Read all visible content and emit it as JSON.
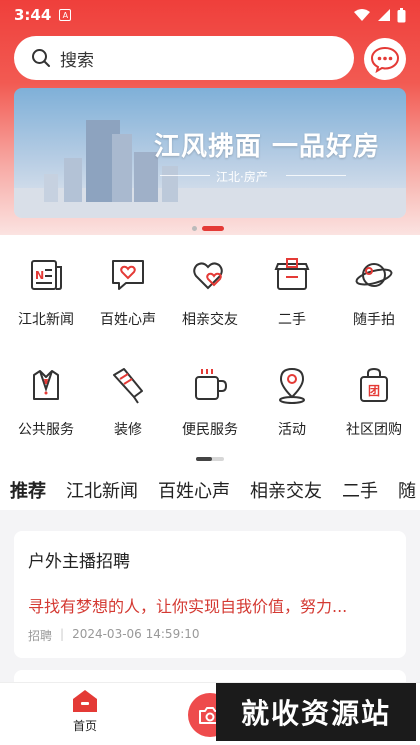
{
  "statusbar": {
    "time": "3:44",
    "a_label": "A"
  },
  "search": {
    "placeholder": "搜索"
  },
  "banner": {
    "title": "江风拂面 一品好房",
    "subtitle": "江北·房产"
  },
  "grid": [
    {
      "label": "江北新闻",
      "icon": "newspaper-icon"
    },
    {
      "label": "百姓心声",
      "icon": "heart-message-icon"
    },
    {
      "label": "相亲交友",
      "icon": "double-heart-icon"
    },
    {
      "label": "二手",
      "icon": "box-icon"
    },
    {
      "label": "随手拍",
      "icon": "planet-icon"
    },
    {
      "label": "公共服务",
      "icon": "suit-icon"
    },
    {
      "label": "装修",
      "icon": "paint-brush-icon"
    },
    {
      "label": "便民服务",
      "icon": "cup-icon"
    },
    {
      "label": "活动",
      "icon": "location-pin-icon"
    },
    {
      "label": "社区团购",
      "icon": "shopping-bag-icon"
    }
  ],
  "tabs": [
    "推荐",
    "江北新闻",
    "百姓心声",
    "相亲交友",
    "二手",
    "随"
  ],
  "post": {
    "title": "户外主播招聘",
    "desc": "寻找有梦想的人，让你实现自我价值，努力...",
    "category": "招聘",
    "time": "2024-03-06 14:59:10"
  },
  "nav": {
    "home_label": "首页"
  },
  "watermark": "就收资源站",
  "colors": {
    "accent": "#e43a36",
    "desc": "#d43a33"
  }
}
